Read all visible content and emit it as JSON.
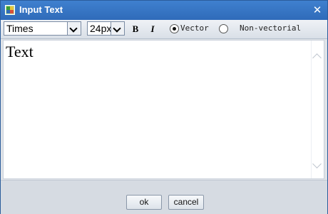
{
  "dialog": {
    "title": "Input Text",
    "close_symbol": "✕",
    "app_icon": "app-icon",
    "close_icon": "close-icon"
  },
  "toolbar": {
    "font_family": "Times",
    "font_size": "24px",
    "bold_label": "B",
    "italic_label": "I",
    "render_mode": {
      "options": [
        {
          "label": "Vector",
          "selected": true
        },
        {
          "label": "Non-vectorial",
          "selected": false
        }
      ]
    }
  },
  "editor": {
    "content": "Text"
  },
  "footer": {
    "ok_label": "ok",
    "cancel_label": "cancel"
  },
  "colors": {
    "titlebar": "#2f6bb9",
    "dialog_border": "#2b5d9c"
  }
}
